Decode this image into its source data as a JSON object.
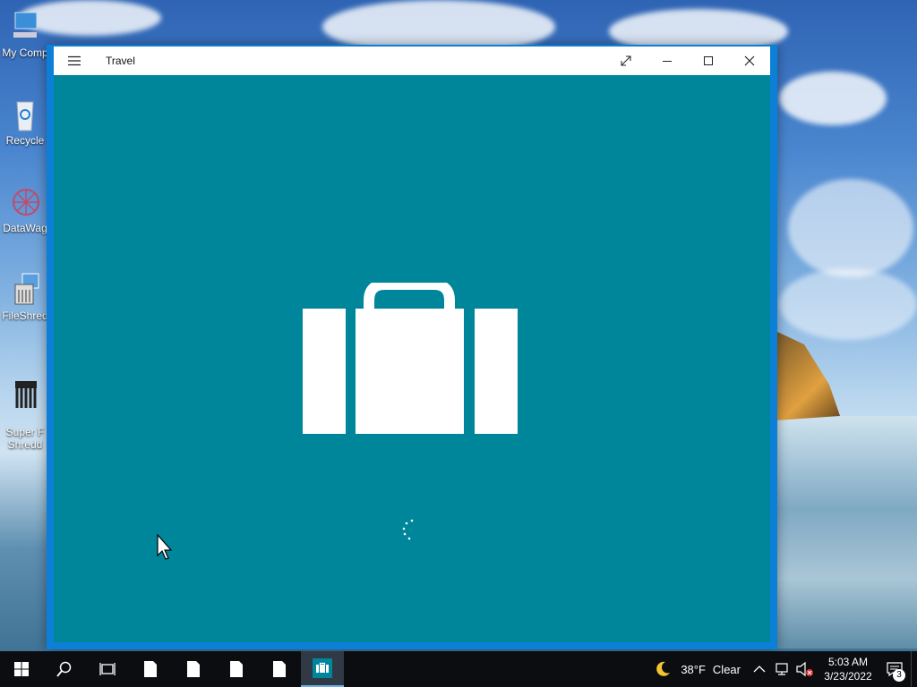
{
  "desktop": {
    "icons": [
      {
        "label": "My Comp",
        "icon": "computer-icon"
      },
      {
        "label": "Recycle",
        "icon": "recycle-bin-icon"
      },
      {
        "label": "DataWag",
        "icon": "datawag-icon"
      },
      {
        "label": "FileShred",
        "icon": "fileshredder-icon"
      },
      {
        "label": "Super F\nShredd",
        "icon": "shredder-icon"
      }
    ]
  },
  "window": {
    "title": "Travel",
    "app_icon": "suitcase-icon",
    "splash_color": "#00869a",
    "loading": true
  },
  "taskbar": {
    "items": [
      "start-icon",
      "search-icon",
      "task-view-icon",
      "file-icon",
      "file-icon",
      "file-icon",
      "file-icon",
      "travel-app-icon"
    ],
    "weather": {
      "icon": "moon-icon",
      "temp": "38°F",
      "condition": "Clear"
    },
    "clock": {
      "time": "5:03 AM",
      "date": "3/23/2022"
    },
    "notifications": "3"
  },
  "colors": {
    "accent": "#0c7fd7",
    "splash": "#00869a",
    "taskbar": "#0b0d10"
  }
}
